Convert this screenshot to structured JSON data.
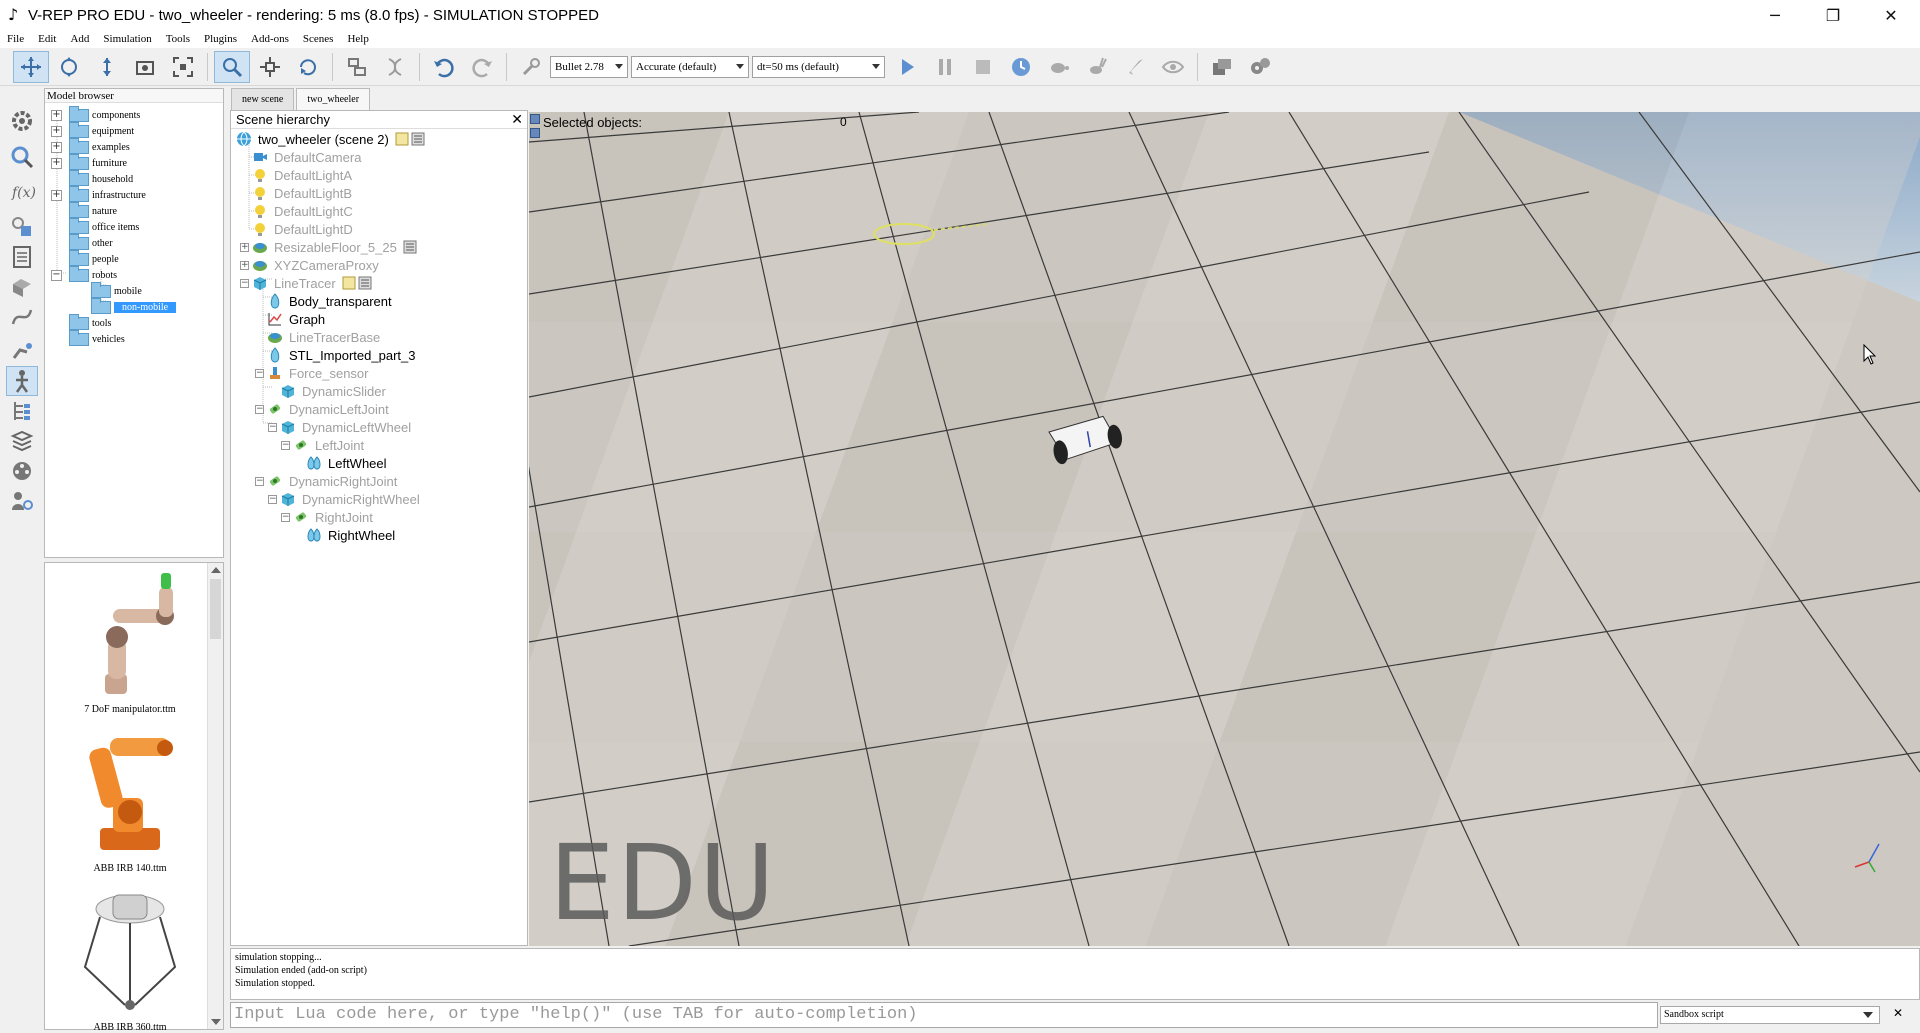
{
  "window": {
    "title": "V-REP PRO EDU - two_wheeler - rendering: 5 ms (8.0 fps) - SIMULATION STOPPED",
    "minimize": "─",
    "restore": "❐",
    "close": "✕"
  },
  "menu": [
    "File",
    "Edit",
    "Add",
    "Simulation",
    "Tools",
    "Plugins",
    "Add-ons",
    "Scenes",
    "Help"
  ],
  "toolbar": {
    "engine": "Bullet 2.78",
    "accuracy": "Accurate (default)",
    "timestep": "dt=50 ms (default)"
  },
  "model_browser": {
    "title": "Model browser",
    "items": [
      {
        "label": "components",
        "expandable": true
      },
      {
        "label": "equipment",
        "expandable": true
      },
      {
        "label": "examples",
        "expandable": true
      },
      {
        "label": "furniture",
        "expandable": true
      },
      {
        "label": "household",
        "expandable": false
      },
      {
        "label": "infrastructure",
        "expandable": true
      },
      {
        "label": "nature",
        "expandable": false
      },
      {
        "label": "office items",
        "expandable": false
      },
      {
        "label": "other",
        "expandable": false
      },
      {
        "label": "people",
        "expandable": false
      },
      {
        "label": "robots",
        "expandable": true,
        "expanded": true
      },
      {
        "label": "mobile",
        "child": true
      },
      {
        "label": "non-mobile",
        "child": true,
        "selected": true
      },
      {
        "label": "tools",
        "expandable": false
      },
      {
        "label": "vehicles",
        "expandable": false
      }
    ]
  },
  "model_thumbs": [
    {
      "caption": "7 DoF manipulator.ttm"
    },
    {
      "caption": "ABB IRB 140.ttm"
    },
    {
      "caption": "ABB IRB 360.ttm"
    }
  ],
  "tabs": [
    {
      "label": "new scene",
      "active": false
    },
    {
      "label": "two_wheeler",
      "active": true
    }
  ],
  "scene_hierarchy": {
    "title": "Scene hierarchy",
    "close": "✕",
    "items": [
      {
        "label": "two_wheeler (scene 2)",
        "depth": 0,
        "icon": "globe",
        "dim": false
      },
      {
        "label": "DefaultCamera",
        "depth": 1,
        "icon": "camera",
        "dim": true
      },
      {
        "label": "DefaultLightA",
        "depth": 1,
        "icon": "light",
        "dim": true
      },
      {
        "label": "DefaultLightB",
        "depth": 1,
        "icon": "light",
        "dim": true
      },
      {
        "label": "DefaultLightC",
        "depth": 1,
        "icon": "light",
        "dim": true
      },
      {
        "label": "DefaultLightD",
        "depth": 1,
        "icon": "light",
        "dim": true
      },
      {
        "label": "ResizableFloor_5_25",
        "depth": 1,
        "icon": "model",
        "dim": true
      },
      {
        "label": "XYZCameraProxy",
        "depth": 1,
        "icon": "model",
        "dim": true
      },
      {
        "label": "LineTracer",
        "depth": 1,
        "icon": "cube",
        "dim": true
      },
      {
        "label": "Body_transparent",
        "depth": 2,
        "icon": "shape",
        "dim": false
      },
      {
        "label": "Graph",
        "depth": 2,
        "icon": "graph",
        "dim": false
      },
      {
        "label": "LineTracerBase",
        "depth": 2,
        "icon": "model",
        "dim": true
      },
      {
        "label": "STL_Imported_part_3",
        "depth": 2,
        "icon": "shape",
        "dim": false
      },
      {
        "label": "Force_sensor",
        "depth": 2,
        "icon": "sensor",
        "dim": true
      },
      {
        "label": "DynamicSlider",
        "depth": 3,
        "icon": "cube",
        "dim": true
      },
      {
        "label": "DynamicLeftJoint",
        "depth": 2,
        "icon": "joint",
        "dim": true
      },
      {
        "label": "DynamicLeftWheel",
        "depth": 3,
        "icon": "cube",
        "dim": true
      },
      {
        "label": "LeftJoint",
        "depth": 4,
        "icon": "joint",
        "dim": true
      },
      {
        "label": "LeftWheel",
        "depth": 5,
        "icon": "shapes",
        "dim": false
      },
      {
        "label": "DynamicRightJoint",
        "depth": 2,
        "icon": "joint",
        "dim": true
      },
      {
        "label": "DynamicRightWheel",
        "depth": 3,
        "icon": "cube",
        "dim": true
      },
      {
        "label": "RightJoint",
        "depth": 4,
        "icon": "joint",
        "dim": true
      },
      {
        "label": "RightWheel",
        "depth": 5,
        "icon": "shapes",
        "dim": false
      }
    ]
  },
  "viewport": {
    "selected_label": "Selected objects:",
    "selected_count": "0",
    "watermark": "EDU"
  },
  "console": {
    "lines": [
      "simulation stopping...",
      "Simulation ended (add-on script)",
      "Simulation stopped."
    ]
  },
  "command": {
    "placeholder": "Input Lua code here, or type \"help()\" (use TAB for auto-completion)",
    "script": "Sandbox script",
    "close": "✕"
  }
}
